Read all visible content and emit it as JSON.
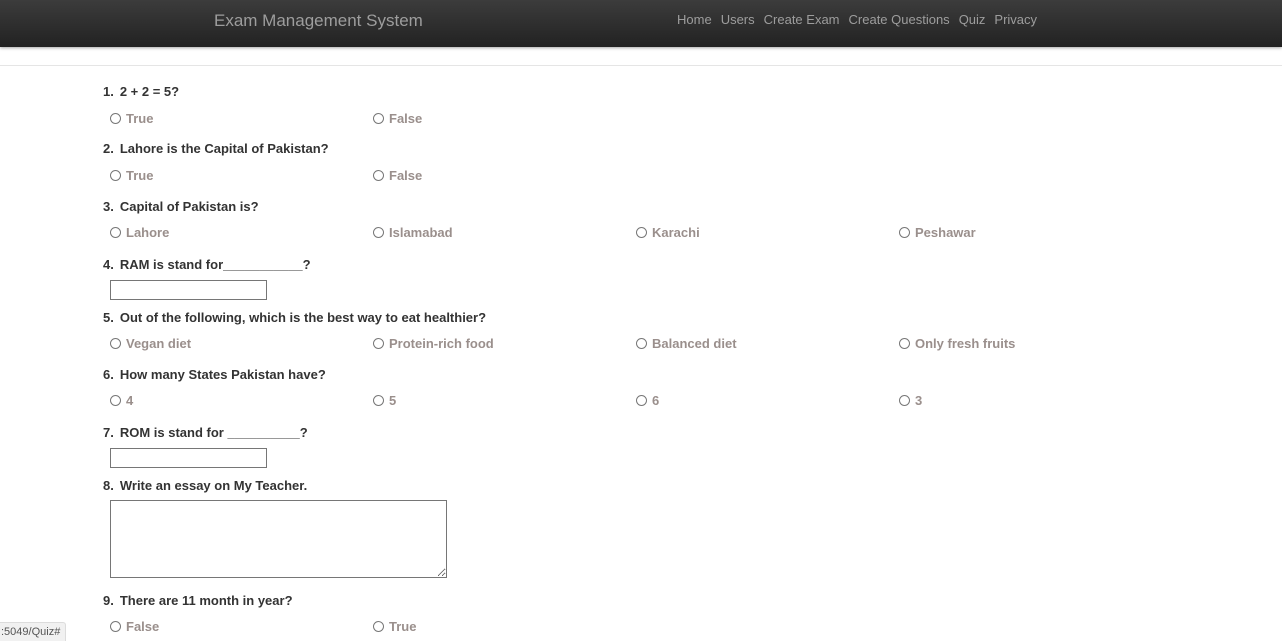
{
  "nav": {
    "brand": "Exam Management System",
    "links": [
      "Home",
      "Users",
      "Create Exam",
      "Create Questions",
      "Quiz",
      "Privacy"
    ]
  },
  "questions": [
    {
      "number": "1.",
      "text": "2 + 2 = 5?",
      "options": [
        "True",
        "False"
      ]
    },
    {
      "number": "2.",
      "text": "Lahore is the Capital of Pakistan?",
      "options": [
        "True",
        "False"
      ]
    },
    {
      "number": "3.",
      "text": "Capital of Pakistan is?",
      "options": [
        "Lahore",
        "Islamabad",
        "Karachi",
        "Peshawar"
      ]
    },
    {
      "number": "4.",
      "text": "RAM is stand for___________?",
      "input_value": ""
    },
    {
      "number": "5.",
      "text": "Out of the following, which is the best way to eat healthier?",
      "options": [
        "Vegan diet",
        "Protein-rich food",
        "Balanced diet",
        "Only fresh fruits"
      ]
    },
    {
      "number": "6.",
      "text": "How many States Pakistan have?",
      "options": [
        "4",
        "5",
        "6",
        "3"
      ]
    },
    {
      "number": "7.",
      "text": "ROM is stand for __________?",
      "input_value": ""
    },
    {
      "number": "8.",
      "text": "Write an essay on My Teacher.",
      "textarea_value": ""
    },
    {
      "number": "9.",
      "text": "There are 11 month in year?",
      "options": [
        "False",
        "True"
      ]
    }
  ],
  "status_bar": {
    "url": ":5049/Quiz#"
  }
}
